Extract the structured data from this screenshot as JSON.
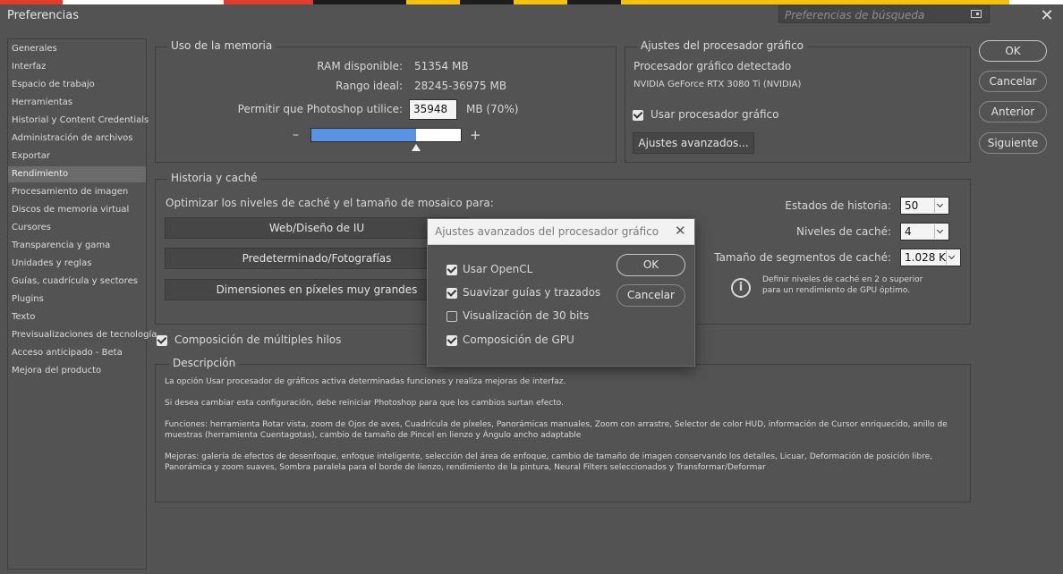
{
  "window": {
    "title": "Preferencias"
  },
  "search": {
    "placeholder": "Preferencias de búsqueda",
    "icon": "panel-icon"
  },
  "colors": {
    "strip": [
      "#e23b2f",
      "#ffffff",
      "#e23b2f",
      "#1c1c1c",
      "#f4c20d",
      "#1c1c1c",
      "#f4c20d",
      "#1c1c1c",
      "#f4c20d",
      "#ffffff"
    ],
    "slider_fill": "#5b93e3",
    "window_bg": "#535353"
  },
  "sidebar": {
    "items": [
      "Generales",
      "Interfaz",
      "Espacio de trabajo",
      "Herramientas",
      "Historial y Content Credentials",
      "Administración de archivos",
      "Exportar",
      "Rendimiento",
      "Procesamiento de imagen",
      "Discos de memoria virtual",
      "Cursores",
      "Transparencia y gama",
      "Unidades y reglas",
      "Guías, cuadrícula y sectores",
      "Plugins",
      "Texto",
      "Previsualizaciones de tecnología",
      "Acceso anticipado - Beta",
      "Mejora del producto"
    ],
    "selected_index": 7
  },
  "memory": {
    "title": "Uso de la memoria",
    "ram_label": "RAM disponible:",
    "ram_value": "51354 MB",
    "ideal_label": "Rango ideal:",
    "ideal_value": "28245-36975 MB",
    "allow_label": "Permitir que Photoshop utilice:",
    "allow_value": "35948",
    "allow_suffix": "MB (70%)",
    "minus": "–",
    "plus": "+",
    "slider_fraction": 0.7
  },
  "gpu": {
    "title": "Ajustes del procesador gráfico",
    "detected_label": "Procesador gráfico detectado",
    "gpu_name": "NVIDIA GeForce RTX 3080 Ti (NVIDIA)",
    "use_gpu_label": "Usar procesador gráfico",
    "use_gpu_checked": true,
    "advanced_button": "Ajustes avanzados..."
  },
  "actions": {
    "ok": "OK",
    "cancel": "Cancelar",
    "prev": "Anterior",
    "next": "Siguiente"
  },
  "cache": {
    "title": "Historia y caché",
    "optimize_label": "Optimizar los niveles de caché y el tamaño de mosaico para:",
    "presets": [
      "Web/Diseño de IU",
      "Predeterminado/Fotografías",
      "Dimensiones en píxeles muy grandes"
    ],
    "history_label": "Estados de historia:",
    "history_value": "50",
    "levels_label": "Niveles de caché:",
    "levels_value": "4",
    "tile_label": "Tamaño de segmentos de caché:",
    "tile_value": "1.028 K",
    "info_text": "Definir niveles de caché en 2 o superior para un rendimiento de GPU óptimo."
  },
  "multithread": {
    "label": "Composición de múltiples hilos",
    "checked": true
  },
  "description": {
    "title": "Descripción",
    "paragraphs": [
      "La opción Usar procesador de gráficos activa determinadas funciones y realiza mejoras de interfaz.",
      "Si desea cambiar esta configuración, debe reiniciar Photoshop para que los cambios surtan efecto.",
      "Funciones: herramienta Rotar vista, zoom de Ojos de aves, Cuadrícula de píxeles, Panorámicas manuales, Zoom con arrastre, Selector de color HUD, información de Cursor enriquecido, anillo de muestras (herramienta Cuentagotas), cambio de tamaño de Pincel en lienzo y Ángulo ancho adaptable",
      "Mejoras: galería de efectos de desenfoque, enfoque inteligente, selección del área de enfoque, cambio de tamaño de imagen conservando los detalles, Licuar, Deformación de posición libre, Panorámica y zoom suaves, Sombra paralela para el borde de lienzo, rendimiento de la pintura, Neural Filters seleccionados y Transformar/Deformar"
    ]
  },
  "modal": {
    "title": "Ajustes avanzados del procesador gráfico",
    "options": [
      {
        "label": "Usar OpenCL",
        "checked": true
      },
      {
        "label": "Suavizar guías y trazados",
        "checked": true
      },
      {
        "label": "Visualización de 30 bits",
        "checked": false
      },
      {
        "label": "Composición de GPU",
        "checked": true
      }
    ],
    "ok": "OK",
    "cancel": "Cancelar"
  }
}
